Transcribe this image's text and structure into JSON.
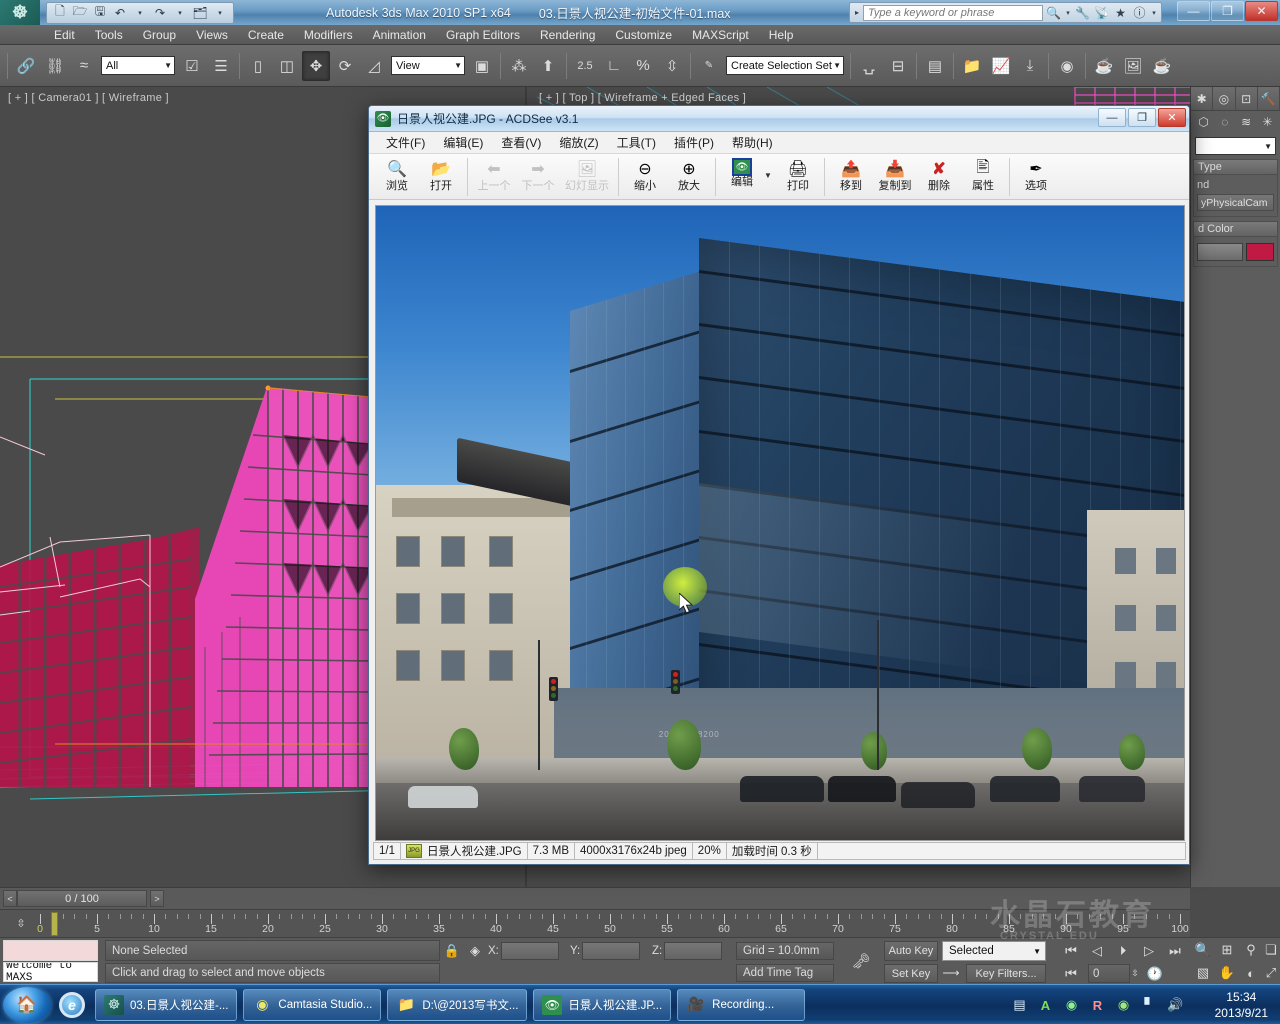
{
  "max": {
    "title": "Autodesk 3ds Max  2010 SP1 x64",
    "file": "03.日景人视公建-初始文件-01.max",
    "logo": "3ds-max-logo",
    "search_placeholder": "Type a keyword or phrase",
    "quick_access": [
      {
        "name": "new-file-icon",
        "glyph": "🗋"
      },
      {
        "name": "open-file-icon",
        "glyph": "🗁"
      },
      {
        "name": "save-file-icon",
        "glyph": "🖫"
      },
      {
        "name": "undo-icon",
        "glyph": "↶"
      },
      {
        "name": "undo-dropdown-icon",
        "glyph": "▾"
      },
      {
        "name": "redo-icon",
        "glyph": "↷"
      },
      {
        "name": "redo-dropdown-icon",
        "glyph": "▾"
      },
      {
        "name": "project-folder-icon",
        "glyph": "🗂"
      },
      {
        "name": "qat-dropdown-icon",
        "glyph": "▾"
      }
    ],
    "search_icons": [
      {
        "name": "binoculars-icon",
        "glyph": "👓"
      },
      {
        "name": "binoculars-dropdown-icon",
        "glyph": "▾"
      },
      {
        "name": "wrench-icon",
        "glyph": "🔧"
      },
      {
        "name": "satellite-dish-icon",
        "glyph": "📡"
      },
      {
        "name": "favorites-star-icon",
        "glyph": "★"
      },
      {
        "name": "help-question-icon",
        "glyph": "?"
      },
      {
        "name": "help-dropdown-icon",
        "glyph": "▾"
      }
    ],
    "window_buttons": [
      {
        "name": "minimize-button",
        "glyph": "—"
      },
      {
        "name": "restore-button",
        "glyph": "❐"
      },
      {
        "name": "close-button",
        "glyph": "✕"
      }
    ],
    "menus": [
      "Edit",
      "Tools",
      "Group",
      "Views",
      "Create",
      "Modifiers",
      "Animation",
      "Graph Editors",
      "Rendering",
      "Customize",
      "MAXScript",
      "Help"
    ],
    "toolbar": {
      "select_filter": "All",
      "ref_coord_system": "View",
      "named_selection_set": "Create Selection Set",
      "buttons": [
        {
          "name": "select-and-link-icon",
          "glyph": "🔗"
        },
        {
          "name": "unlink-selection-icon",
          "glyph": "⛓"
        },
        {
          "name": "bind-to-space-warp-icon",
          "glyph": "≋"
        },
        {
          "name": "select-object-icon",
          "glyph": "⬚"
        },
        {
          "name": "select-by-name-icon",
          "glyph": "☰"
        },
        {
          "name": "rectangular-selection-region-icon",
          "glyph": "▭"
        },
        {
          "name": "window-crossing-icon",
          "glyph": "◳"
        },
        {
          "name": "select-and-move-icon",
          "glyph": "✥"
        },
        {
          "name": "select-and-rotate-icon",
          "glyph": "⟳"
        },
        {
          "name": "select-and-scale-icon",
          "glyph": "◹"
        },
        {
          "name": "use-pivot-center-icon",
          "glyph": "▣"
        },
        {
          "name": "select-and-manipulate-icon",
          "glyph": "⁂"
        },
        {
          "name": "keyboard-shortcut-override-icon",
          "glyph": "⬆"
        },
        {
          "name": "snaps-toggle-icon",
          "glyph": "2.5"
        },
        {
          "name": "angle-snap-toggle-icon",
          "glyph": "∠"
        },
        {
          "name": "percent-snap-toggle-icon",
          "glyph": "%"
        },
        {
          "name": "spinner-snap-toggle-icon",
          "glyph": "⇳"
        },
        {
          "name": "edit-named-selection-sets-icon",
          "glyph": "ABC"
        },
        {
          "name": "mirror-icon",
          "glyph": "◫"
        },
        {
          "name": "align-icon",
          "glyph": "⊟"
        },
        {
          "name": "layer-manager-icon",
          "glyph": "▤"
        },
        {
          "name": "graph-editors-icon",
          "glyph": "🗁"
        },
        {
          "name": "curve-editor-icon",
          "glyph": "📈"
        },
        {
          "name": "schematic-view-icon",
          "glyph": "⤓"
        },
        {
          "name": "material-editor-icon",
          "glyph": "◍"
        },
        {
          "name": "render-setup-icon",
          "glyph": "🫖"
        },
        {
          "name": "rendered-frame-window-icon",
          "glyph": "🖼"
        },
        {
          "name": "render-production-icon",
          "glyph": "🫖"
        }
      ]
    },
    "viewports": [
      {
        "name": "viewport-camera01",
        "label": "[ + ] [ Camera01 ] [ Wireframe ]"
      },
      {
        "name": "viewport-top",
        "label": "[ + ] [ Top ] [ Wireframe + Edged Faces ]"
      }
    ],
    "command_panel": {
      "tabs": [
        {
          "name": "create-tab-icon",
          "glyph": "✱"
        },
        {
          "name": "modify-tab-icon",
          "glyph": "◉"
        },
        {
          "name": "hierarchy-tab-icon",
          "glyph": "⊡"
        },
        {
          "name": "motion-tab-icon",
          "glyph": "🔨"
        }
      ],
      "sub_icons": [
        {
          "name": "geometry-icon",
          "glyph": "⬡"
        },
        {
          "name": "shapes-icon",
          "glyph": "◌"
        },
        {
          "name": "lights-icon",
          "glyph": "≋"
        },
        {
          "name": "helpers-icon",
          "glyph": "✳"
        }
      ],
      "category_value": "",
      "rollouts": [
        {
          "name": "object-type-rollout",
          "title": "Type",
          "lines": [
            "nd"
          ],
          "button": "yPhysicalCam"
        },
        {
          "name": "color-rollout",
          "title": "d Color",
          "swatch": "#c01a44"
        }
      ]
    },
    "timeslider": {
      "prev_label": "<",
      "frame_label": "0 / 100",
      "next_label": ">",
      "cursor_frame": 0
    },
    "trackbar": {
      "start": 0,
      "end": 100,
      "major_step": 5,
      "labels": [
        5,
        10,
        15,
        20,
        25,
        30,
        35,
        40,
        45,
        50,
        55,
        60,
        65,
        70,
        75,
        80,
        85,
        90,
        95,
        100
      ]
    },
    "statusbar": {
      "maxscript_mini_listener": "Welcome to MAXS",
      "selection_status": "None Selected",
      "prompt": "Click and drag to select and move objects",
      "lock_icon": "lock-selection-icon",
      "absolute_mode_icon": "absolute-relative-transform-icon",
      "coords": [
        {
          "name": "coord-x",
          "label": "X:",
          "value": ""
        },
        {
          "name": "coord-y",
          "label": "Y:",
          "value": ""
        },
        {
          "name": "coord-z",
          "label": "Z:",
          "value": ""
        }
      ],
      "grid": "Grid = 10.0mm",
      "add_time_tag": "Add Time Tag",
      "key_mode_icon": "key-mode-toggle-icon",
      "auto_key": "Auto Key",
      "set_key": "Set Key",
      "key_filter_selection": "Selected",
      "key_filters": "Key Filters...",
      "current_frame_field": "0",
      "playback_icons": [
        {
          "name": "goto-start-icon",
          "glyph": "|◀◀"
        },
        {
          "name": "previous-frame-icon",
          "glyph": "◀|"
        },
        {
          "name": "play-animation-icon",
          "glyph": "▶"
        },
        {
          "name": "next-frame-icon",
          "glyph": "|▶"
        },
        {
          "name": "goto-end-icon",
          "glyph": "▶▶|"
        },
        {
          "name": "key-mode-toggle-icon",
          "glyph": "|◀▶|"
        }
      ],
      "nav_icons": [
        {
          "name": "zoom-icon",
          "glyph": "🔍"
        },
        {
          "name": "zoom-all-icon",
          "glyph": "⊞"
        },
        {
          "name": "zoom-extents-icon",
          "glyph": "⛶"
        },
        {
          "name": "zoom-extents-all-icon",
          "glyph": "❏"
        },
        {
          "name": "field-of-view-icon",
          "glyph": "⬚"
        },
        {
          "name": "pan-view-icon",
          "glyph": "✋"
        },
        {
          "name": "orbit-icon",
          "glyph": "◐"
        },
        {
          "name": "maximize-viewport-toggle-icon",
          "glyph": "⤢"
        },
        {
          "name": "time-configuration-icon",
          "glyph": "🕐"
        }
      ],
      "watermark": "水晶石教育",
      "watermark_sub": "CRYSTAL EDU"
    }
  },
  "acdsee": {
    "title": "日景人视公建.JPG - ACDSee v3.1",
    "app_icon": "acdsee-eye-icon",
    "window_buttons": [
      {
        "name": "minimize-button",
        "glyph": "—"
      },
      {
        "name": "restore-button",
        "glyph": "❐"
      },
      {
        "name": "close-button",
        "glyph": "✕"
      }
    ],
    "menus": [
      "文件(F)",
      "编辑(E)",
      "查看(V)",
      "缩放(Z)",
      "工具(T)",
      "插件(P)",
      "帮助(H)"
    ],
    "toolbar": [
      {
        "name": "browse-button",
        "label": "浏览",
        "glyph": "🔍",
        "disabled": false
      },
      {
        "name": "open-button",
        "label": "打开",
        "glyph": "📂",
        "disabled": false
      },
      {
        "name": "previous-button",
        "label": "上一个",
        "glyph": "⬅",
        "disabled": true
      },
      {
        "name": "next-button",
        "label": "下一个",
        "glyph": "➡",
        "disabled": true
      },
      {
        "name": "slideshow-button",
        "label": "幻灯显示",
        "glyph": "🖼",
        "disabled": true
      },
      {
        "name": "zoom-out-button",
        "label": "缩小",
        "glyph": "⊖",
        "disabled": false
      },
      {
        "name": "zoom-in-button",
        "label": "放大",
        "glyph": "⊕",
        "disabled": false
      },
      {
        "name": "edit-button",
        "label": "编辑",
        "glyph": "🖼",
        "disabled": false
      },
      {
        "name": "print-button",
        "label": "打印",
        "glyph": "🖨",
        "disabled": false
      },
      {
        "name": "move-to-button",
        "label": "移到",
        "glyph": "📄",
        "disabled": false
      },
      {
        "name": "copy-to-button",
        "label": "复制到",
        "glyph": "📄",
        "disabled": false
      },
      {
        "name": "delete-button",
        "label": "删除",
        "glyph": "✕",
        "disabled": false
      },
      {
        "name": "properties-button",
        "label": "属性",
        "glyph": "📋",
        "disabled": false
      },
      {
        "name": "options-button",
        "label": "选项",
        "glyph": "✎",
        "disabled": false
      }
    ],
    "status": {
      "page": "1/1",
      "format_icon": "jpg-format-icon",
      "filename": "日景人视公建.JPG",
      "filesize": "7.3 MB",
      "dimensions": "4000x3176x24b jpeg",
      "zoom": "20%",
      "load_time": "加载时间 0.3 秒"
    },
    "image": {
      "name": "architectural-render-photo",
      "description": "日景人视公建 glass office building daylight render"
    }
  },
  "taskbar": {
    "start_button": "start-orb",
    "quick_launch": [
      {
        "name": "internet-explorer-icon",
        "glyph": "e"
      }
    ],
    "tasks": [
      {
        "name": "taskbar-item-3dsmax",
        "label": "03.日景人视公建-...",
        "icon": "3ds-max-icon"
      },
      {
        "name": "taskbar-item-camtasia",
        "label": "Camtasia Studio...",
        "icon": "camtasia-icon"
      },
      {
        "name": "taskbar-item-explorer",
        "label": "D:\\@2013写书文...",
        "icon": "folder-icon"
      },
      {
        "name": "taskbar-item-acdsee",
        "label": "日景人视公建.JP...",
        "icon": "acdsee-eye-icon"
      },
      {
        "name": "taskbar-item-recording",
        "label": "Recording...",
        "icon": "camcorder-icon"
      }
    ],
    "tray": [
      {
        "name": "show-hidden-icons-icon",
        "glyph": "▤"
      },
      {
        "name": "ime-language-icon",
        "glyph": "A"
      },
      {
        "name": "green-shield-icon",
        "glyph": "◉"
      },
      {
        "name": "antivirus-icon",
        "glyph": "R"
      },
      {
        "name": "nvidia-icon",
        "glyph": "◉"
      },
      {
        "name": "network-icon",
        "glyph": "▮"
      },
      {
        "name": "volume-icon",
        "glyph": "🔊"
      }
    ],
    "clock": {
      "time": "15:34",
      "date": "2013/9/21"
    }
  }
}
